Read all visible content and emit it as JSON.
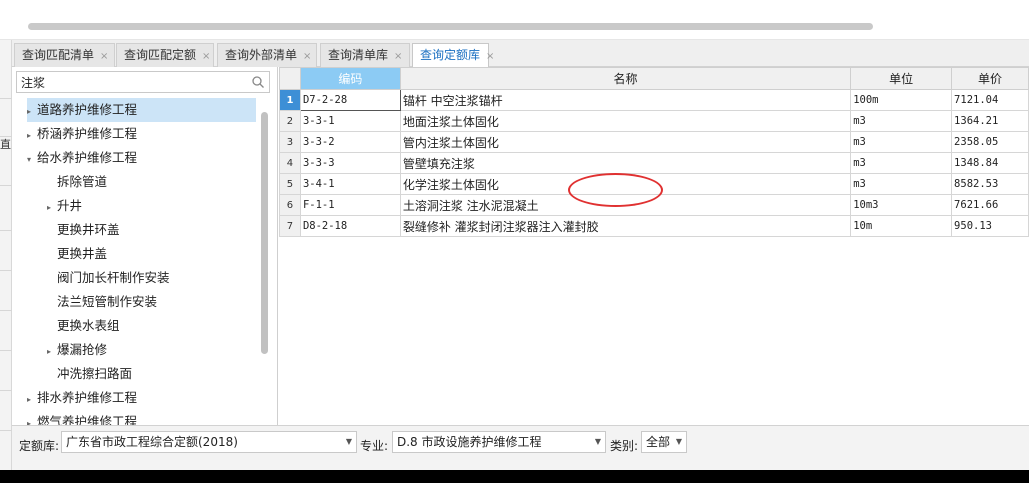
{
  "tabs": [
    {
      "label": "查询匹配清单",
      "close": "×",
      "active": false
    },
    {
      "label": "查询匹配定额",
      "close": "×",
      "active": false
    },
    {
      "label": "查询外部清单",
      "close": "×",
      "active": false
    },
    {
      "label": "查询清单库",
      "close": "×",
      "active": false
    },
    {
      "label": "查询定额库",
      "close": "×",
      "active": true
    }
  ],
  "left_glyph": "直",
  "search": {
    "value": "注浆",
    "icon": "search-icon"
  },
  "tree": [
    {
      "label": "道路养护维修工程",
      "level": 0,
      "arrow": "▸",
      "selected": true
    },
    {
      "label": "桥涵养护维修工程",
      "level": 0,
      "arrow": "▸",
      "selected": false
    },
    {
      "label": "给水养护维修工程",
      "level": 0,
      "arrow": "▾",
      "selected": false
    },
    {
      "label": "拆除管道",
      "level": 1,
      "arrow": "",
      "selected": false
    },
    {
      "label": "升井",
      "level": 1,
      "arrow": "▸",
      "selected": false
    },
    {
      "label": "更换井环盖",
      "level": 1,
      "arrow": "",
      "selected": false
    },
    {
      "label": "更换井盖",
      "level": 1,
      "arrow": "",
      "selected": false
    },
    {
      "label": "阀门加长杆制作安装",
      "level": 1,
      "arrow": "",
      "selected": false
    },
    {
      "label": "法兰短管制作安装",
      "level": 1,
      "arrow": "",
      "selected": false
    },
    {
      "label": "更换水表组",
      "level": 1,
      "arrow": "",
      "selected": false
    },
    {
      "label": "爆漏抢修",
      "level": 1,
      "arrow": "▸",
      "selected": false
    },
    {
      "label": "冲洗擦扫路面",
      "level": 1,
      "arrow": "",
      "selected": false
    },
    {
      "label": "排水养护维修工程",
      "level": 0,
      "arrow": "▸",
      "selected": false
    },
    {
      "label": "燃气养护维修工程",
      "level": 0,
      "arrow": "▸",
      "selected": false
    }
  ],
  "grid": {
    "headers": {
      "code": "编码",
      "name": "名称",
      "unit": "单位",
      "price": "单价"
    },
    "rows": [
      {
        "no": "1",
        "code": "D7-2-28",
        "name": "锚杆 中空注浆锚杆",
        "unit": "100m",
        "price": "7121.04",
        "current": true
      },
      {
        "no": "2",
        "code": "3-3-1",
        "name": "地面注浆土体固化",
        "unit": "m3",
        "price": "1364.21",
        "current": false
      },
      {
        "no": "3",
        "code": "3-3-2",
        "name": "管内注浆土体固化",
        "unit": "m3",
        "price": "2358.05",
        "current": false
      },
      {
        "no": "4",
        "code": "3-3-3",
        "name": "管壁填充注浆",
        "unit": "m3",
        "price": "1348.84",
        "current": false
      },
      {
        "no": "5",
        "code": "3-4-1",
        "name": "化学注浆土体固化",
        "unit": "m3",
        "price": "8582.53",
        "current": false
      },
      {
        "no": "6",
        "code": "F-1-1",
        "name": "土溶洞注浆 注水泥混凝土",
        "unit": "10m3",
        "price": "7621.66",
        "current": false
      },
      {
        "no": "7",
        "code": "D8-2-18",
        "name": "裂缝修补 灌浆封闭注浆器注入灌封胶",
        "unit": "10m",
        "price": "950.13",
        "current": false
      }
    ]
  },
  "bottom": {
    "library_label": "定额库:",
    "library_value": "广东省市政工程综合定额(2018)",
    "major_label": "专业:",
    "major_value": "D.8 市政设施养护维修工程",
    "category_label": "类别:",
    "category_value": "全部",
    "dropdown_icon": "chevron-down-icon"
  },
  "annotation_color": "#e03131"
}
